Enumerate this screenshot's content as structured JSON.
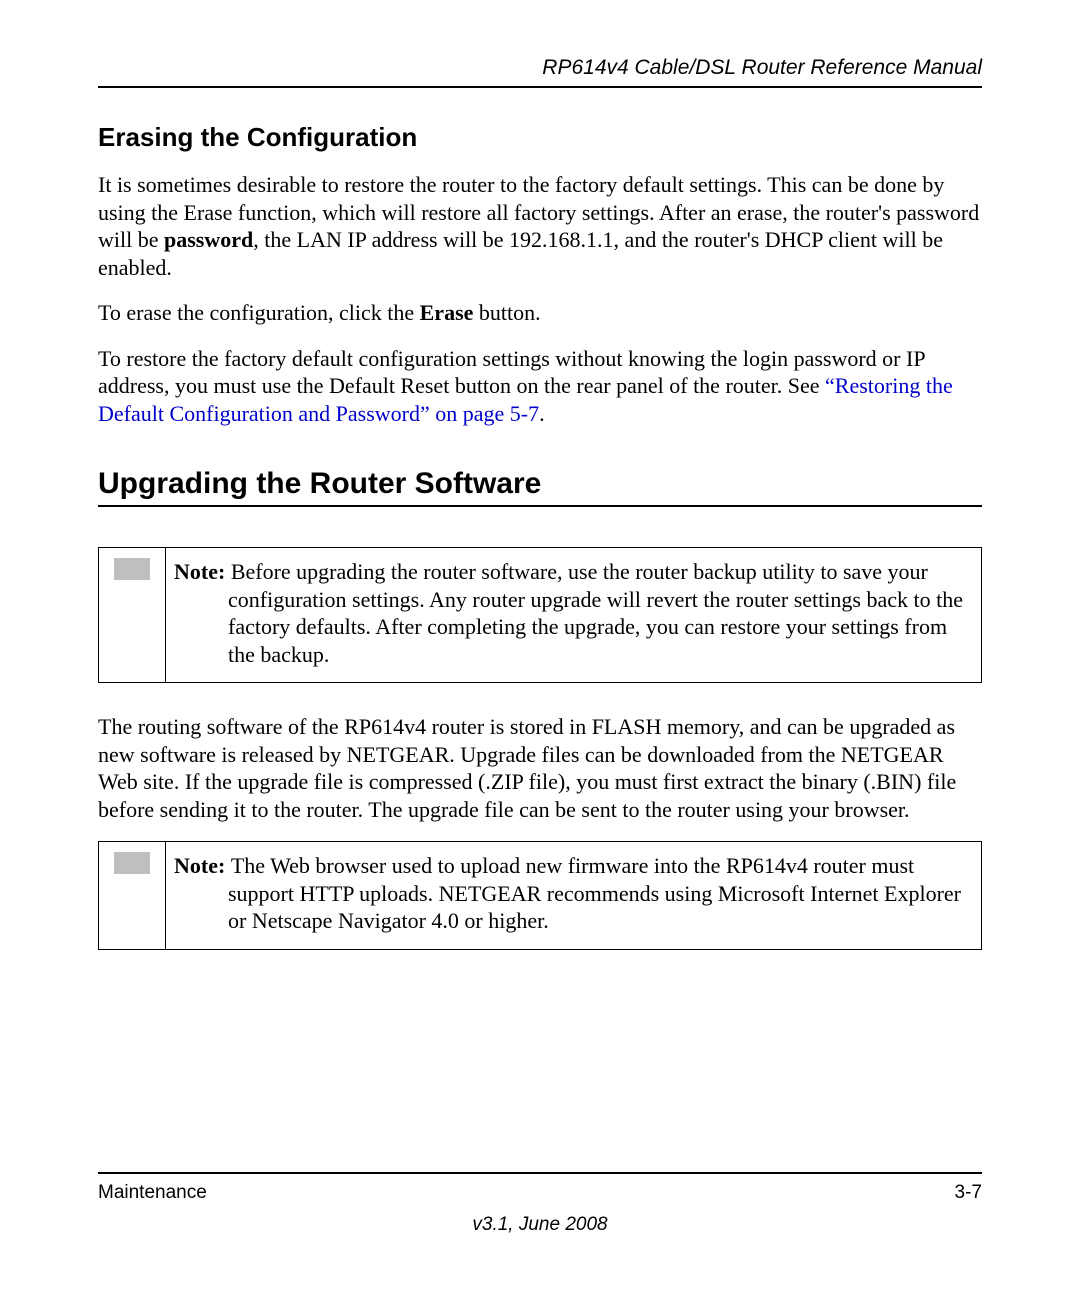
{
  "header": {
    "manual_title": "RP614v4 Cable/DSL Router Reference Manual"
  },
  "section1": {
    "heading": "Erasing the Configuration",
    "para1_a": "It is sometimes desirable to restore the router to the factory default settings. This can be done by using the Erase function, which will restore all factory settings. After an erase, the router's password will be ",
    "para1_bold1": "password",
    "para1_b": ", the LAN IP address will be 192.168.1.1, and the router's DHCP client will be enabled.",
    "para2_a": "To erase the configuration, click the ",
    "para2_bold": "Erase",
    "para2_b": " button.",
    "para3_a": "To restore the factory default configuration settings without knowing the login password or IP address, you must use the Default Reset button on the rear panel of the router. See ",
    "para3_link": "“Restoring the Default Configuration and Password” on page 5-7",
    "para3_b": "."
  },
  "section2": {
    "heading": "Upgrading the Router Software",
    "note1_label": "Note: ",
    "note1_text": "Before upgrading the router software, use the router backup utility to save your configuration settings. Any router upgrade will revert the router settings back to the factory defaults. After completing the upgrade, you can restore your settings from the backup.",
    "para1": "The routing software of the RP614v4 router is stored in FLASH memory, and can be upgraded as new software is released by NETGEAR. Upgrade files can be downloaded from the NETGEAR Web site. If the upgrade file is compressed (.ZIP file), you must first extract the binary (.BIN) file before sending it to the router. The upgrade file can be sent to the router using your browser.",
    "note2_label": "Note: ",
    "note2_text": "The Web browser used to upload new firmware into the RP614v4 router must support HTTP uploads. NETGEAR recommends using Microsoft Internet Explorer or Netscape Navigator 4.0 or higher."
  },
  "footer": {
    "left": "Maintenance",
    "right": "3-7",
    "version": "v3.1, June 2008"
  }
}
